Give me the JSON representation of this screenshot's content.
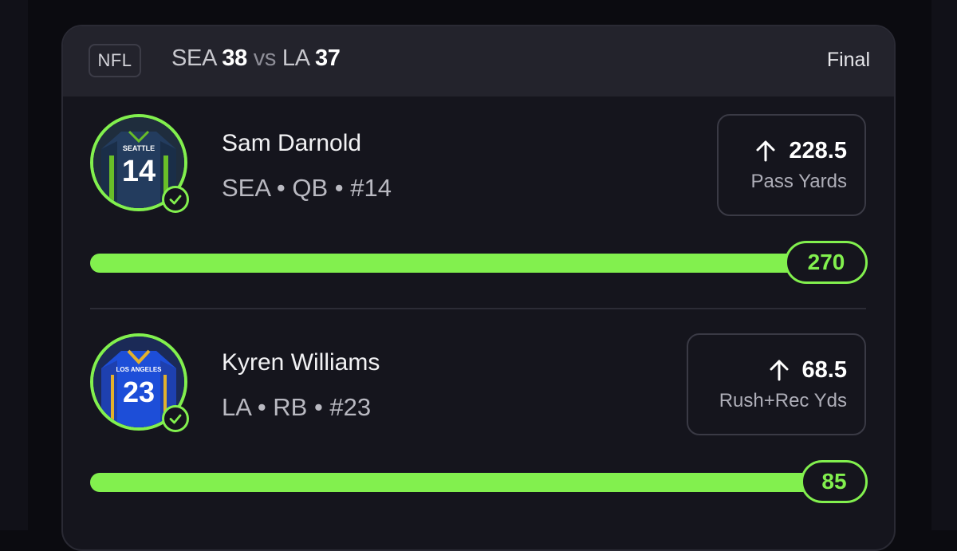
{
  "game": {
    "league": "NFL",
    "home_team": "SEA",
    "home_score": "38",
    "vs": "vs",
    "away_team": "LA",
    "away_score": "37",
    "status": "Final"
  },
  "players": [
    {
      "name": "Sam Darnold",
      "meta": "SEA • QB • #14",
      "jersey_team": "SEATTLE",
      "jersey_number": "14",
      "prop_direction": "over",
      "prop_line": "228.5",
      "prop_label": "Pass Yards",
      "result": "270",
      "progress_fraction": 1.0,
      "hit": true
    },
    {
      "name": "Kyren Williams",
      "meta": "LA • RB • #23",
      "jersey_team": "LOS ANGELES",
      "jersey_number": "23",
      "prop_direction": "over",
      "prop_line": "68.5",
      "prop_label": "Rush+Rec Yds",
      "result": "85",
      "progress_fraction": 1.0,
      "hit": true
    }
  ],
  "colors": {
    "accent": "#82f04e",
    "background": "#0b0b10",
    "card": "#15151d",
    "header": "#23232c",
    "seattle_navy": "#233c5e",
    "seattle_green": "#69be28",
    "la_blue": "#1d4ed8",
    "la_gold": "#e3b12c"
  },
  "icons": {
    "prop_arrow": "arrow-up-icon",
    "hit_marker": "check-circle-icon"
  }
}
